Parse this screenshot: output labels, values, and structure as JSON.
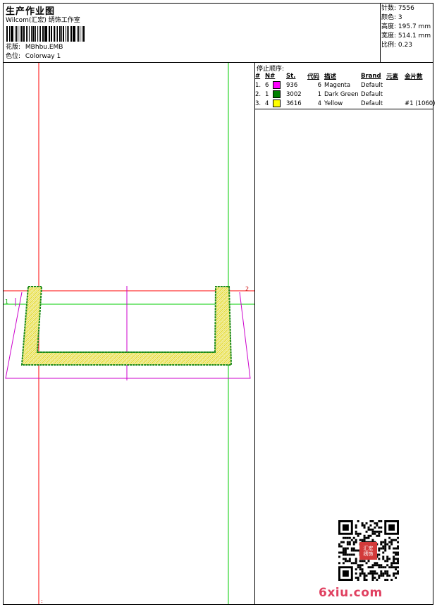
{
  "header": {
    "title": "生产作业图",
    "subtitle": "Wilcom(汇宏) 绣饰工作室",
    "design_label": "花版:",
    "design_file": "MBhbu.EMB",
    "colorway_label": "色位:",
    "colorway": "Colorway 1"
  },
  "stats": {
    "stitches_label": "针数:",
    "stitches": "7556",
    "colors_label": "颜色:",
    "colors": "3",
    "height_label": "高度:",
    "height": "195.7 mm",
    "width_label": "宽度:",
    "width": "514.1 mm",
    "scale_label": "比例:",
    "scale": "0.23"
  },
  "stop_sequence": {
    "title": "停止顺序:",
    "headers": [
      "#",
      "N#",
      "St.",
      "代码",
      "描述",
      "Brand",
      "元素",
      "金片数"
    ],
    "rows": [
      {
        "idx": "1.",
        "n": "6",
        "color": "#ff00ff",
        "st": "936",
        "code": "6",
        "desc": "Magenta",
        "brand": "Default",
        "element": "",
        "sequins": ""
      },
      {
        "idx": "2.",
        "n": "1",
        "color": "#008000",
        "st": "3002",
        "code": "1",
        "desc": "Dark Green",
        "brand": "Default",
        "element": "",
        "sequins": ""
      },
      {
        "idx": "3.",
        "n": "4",
        "color": "#ffff00",
        "st": "3616",
        "code": "4",
        "desc": "Yellow",
        "brand": "Default",
        "element": "",
        "sequins": "#1 (1060)"
      }
    ]
  },
  "canvas": {
    "marker_1": "1",
    "marker_2": "2",
    "marker_bottom": ":",
    "colors": {
      "guide_red": "#ff0000",
      "guide_green": "#00cc00",
      "outline_magenta": "#cc00cc",
      "fill_yellow": "#f5f07a",
      "fill_green": "#1a8a1a"
    }
  },
  "watermark": {
    "logo_text": "6xiu.com",
    "seal_text": "汇宏绣饰"
  }
}
